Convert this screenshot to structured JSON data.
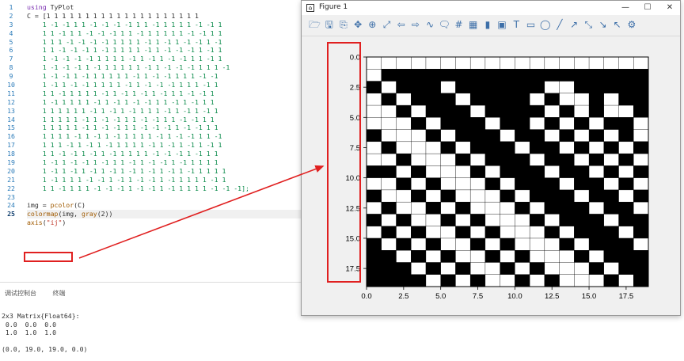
{
  "editor": {
    "line_numbers": [
      "1",
      "2",
      "3",
      "4",
      "5",
      "6",
      "7",
      "8",
      "9",
      "10",
      "11",
      "12",
      "13",
      "14",
      "15",
      "16",
      "17",
      "18",
      "19",
      "20",
      "21",
      "22",
      "23",
      "24",
      "25"
    ],
    "lines": [
      [
        {
          "t": "using ",
          "c": "kw"
        },
        {
          "t": "TyPlot",
          "c": ""
        }
      ],
      [
        {
          "t": "C = [1 1 1 1 1 1 1 1 1 1 1 1 1 1 1 1 1 1 1 1",
          "c": ""
        }
      ],
      [
        {
          "t": "    1 -1 -1 1 1 -1 -1 -1 -1 1 1 -1 1 1 1 1 -1 -1 1",
          "c": "num"
        }
      ],
      [
        {
          "t": "    1 1 -1 1 1 -1 -1 -1 1 1 -1 1 1 1 1 1 -1 -1 1 1",
          "c": "num"
        }
      ],
      [
        {
          "t": "    1 1 1 -1 -1 -1 -1 1 1 1 1 -1 1 -1 1 -1 -1 1 -1",
          "c": "num"
        }
      ],
      [
        {
          "t": "    1 1 -1 -1 -1 1 -1 1 1 1 1 -1 1 -1 -1 -1 1 -1 1",
          "c": "num"
        }
      ],
      [
        {
          "t": "    1 -1 -1 -1 -1 1 1 1 1 -1 1 -1 1 -1 -1 1 1 -1 1",
          "c": "num"
        }
      ],
      [
        {
          "t": "    1 -1 -1 -1 1 -1 1 1 1 1 1 -1 1 -1 -1 -1 1 1 1 -1",
          "c": "num"
        }
      ],
      [
        {
          "t": "    1 -1 -1 1 -1 1 1 1 1 1 -1 1 -1 -1 1 1 1 -1 -1",
          "c": "num"
        }
      ],
      [
        {
          "t": "    1 -1 1 -1 -1 1 1 1 1 -1 1 -1 -1 -1 1 1 1 -1 1",
          "c": "num"
        }
      ],
      [
        {
          "t": "    1 1 -1 1 1 1 1 -1 1 -1 1 -1 1 -1 1 1 -1 -1 1",
          "c": "num"
        }
      ],
      [
        {
          "t": "    1 -1 1 1 1 1 -1 1 -1 1 -1 -1 1 1 -1 1 -1 1 1",
          "c": "num"
        }
      ],
      [
        {
          "t": "    1 1 1 1 1 1 -1 1 -1 1 -1 1 1 1 -1 1 -1 1 -1 1",
          "c": "num"
        }
      ],
      [
        {
          "t": "    1 1 1 1 1 -1 1 -1 -1 1 1 -1 -1 1 1 -1 -1 1 1",
          "c": "num"
        }
      ],
      [
        {
          "t": "    1 1 1 1 1 -1 1 -1 -1 1 1 -1 -1 -1 1 -1 -1 1 1",
          "c": "num"
        }
      ],
      [
        {
          "t": "    1 1 1 1 -1 1 -1 1 -1 1 1 1 1 -1 1 -1 -1 1 1 -1",
          "c": "num"
        }
      ],
      [
        {
          "t": "    1 1 1 -1 1 -1 1 -1 1 1 1 1 -1 1 -1 1 -1 1 -1 1",
          "c": "num"
        }
      ],
      [
        {
          "t": "    1 1 -1 -1 1 -1 1 -1 1 1 1 1 -1 -1 -1 1 -1 1 1",
          "c": "num"
        }
      ],
      [
        {
          "t": "    1 -1 1 -1 -1 1 -1 1 1 -1 1 -1 -1 1 -1 1 1 1 1",
          "c": "num"
        }
      ],
      [
        {
          "t": "    1 -1 1 -1 1 -1 1 -1 1 -1 1 -1 1 -1 1 -1 1 1 1 1",
          "c": "num"
        }
      ],
      [
        {
          "t": "    1 -1 1 1 1 -1 -1 1 -1 1 -1 -1 1 -1 1 1 1 1 -1 1",
          "c": "num"
        }
      ],
      [
        {
          "t": "    1 1 -1 1 1 1 -1 -1 -1 1 -1 -1 1 -1 1 1 1 1 -1 -1 -1];",
          "c": "num"
        }
      ],
      [
        {
          "t": "",
          "c": ""
        }
      ],
      [
        {
          "t": "img = ",
          "c": ""
        },
        {
          "t": "pcolor",
          "c": "fn"
        },
        {
          "t": "(C)",
          "c": ""
        }
      ],
      [
        {
          "t": "colormap",
          "c": "fn"
        },
        {
          "t": "(img, ",
          "c": ""
        },
        {
          "t": "gray",
          "c": "fn"
        },
        {
          "t": "(2))",
          "c": ""
        }
      ],
      [
        {
          "t": "axis",
          "c": "fn"
        },
        {
          "t": "(",
          "c": ""
        },
        {
          "t": "\"ij\"",
          "c": "str"
        },
        {
          "t": ")",
          "c": ""
        }
      ]
    ]
  },
  "bottom_panel": {
    "tabs": [
      "调试控制台",
      "终端"
    ],
    "console_lines": [
      "2x3 Matrix{Float64}:",
      " 0.0  0.0  0.0",
      " 1.0  1.0  1.0",
      "",
      "(0.0, 19.0, 19.0, 0.0)"
    ]
  },
  "figure_window": {
    "title": "Figure 1",
    "controls": {
      "minimize": "—",
      "maximize": "☐",
      "close": "✕"
    },
    "toolbar_icons": [
      "open-icon",
      "save-icon",
      "export-icon",
      "pan-icon",
      "zoom-icon",
      "zoom-fit-icon",
      "back-icon",
      "forward-icon",
      "curve-icon",
      "annotate-icon",
      "grid-icon",
      "table-icon",
      "colorbar-icon",
      "legend-icon",
      "textbox-icon",
      "rectangle-icon",
      "ellipse-icon",
      "line-icon",
      "arrow-icon",
      "double-arrow-icon",
      "diagonal-arrow-icon",
      "pointer-icon",
      "settings-icon"
    ],
    "toolbar_glyphs": [
      "🗁",
      "🖫",
      "⎘",
      "✥",
      "⊕",
      "⤢",
      "⇦",
      "⇨",
      "∿",
      "🗨",
      "#",
      "▦",
      "▮",
      "▣",
      "T",
      "▭",
      "◯",
      "╱",
      "↗",
      "⤡",
      "↘",
      "↖",
      "⚙"
    ]
  },
  "chart_data": {
    "type": "heatmap",
    "colormap": "gray(2)",
    "values": [
      "black",
      "white"
    ],
    "matrix_rows": 19,
    "matrix_cols": 19,
    "xticks": [
      "0.0",
      "2.5",
      "5.0",
      "7.5",
      "10.0",
      "12.5",
      "15.0",
      "17.5"
    ],
    "yticks": [
      "0.0",
      "2.5",
      "5.0",
      "7.5",
      "10.0",
      "12.5",
      "15.0",
      "17.5"
    ],
    "xlim": [
      0,
      19
    ],
    "ylim": [
      0,
      19
    ],
    "y_direction": "ij",
    "grid": true,
    "pattern_rows": [
      "0000000000000000000",
      "0111111111111111111",
      "1011101111110011111",
      "0101110111101001011",
      "0010111011110101001",
      "0001011101101010110",
      "1000101110110101010",
      "0100010111011010101",
      "0010001011101101010",
      "1101000101110110101",
      "0010100010111011010",
      "1001010001011101101",
      "0100101000101110110",
      "1010010100010111011",
      "0101001010001011101",
      "1010100101000101110",
      "1101010010100010111",
      "1110101001010001011",
      "1111010100101000101"
    ]
  }
}
